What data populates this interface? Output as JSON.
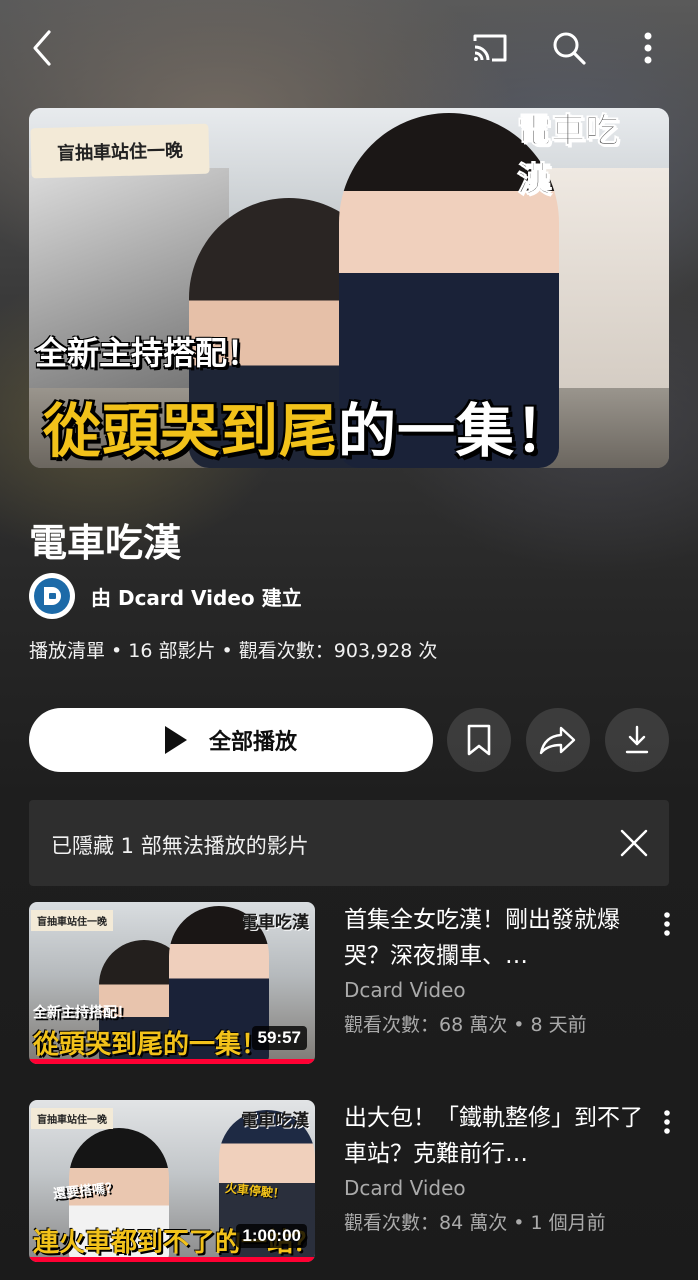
{
  "header": {
    "icons": [
      "back-arrow-icon",
      "cast-icon",
      "search-icon",
      "more-vertical-icon"
    ]
  },
  "hero": {
    "tag": "盲抽車站住一晚",
    "logo": "電車吃漢",
    "caption_small": "全新主持搭配！",
    "caption_big_yellow": "從頭哭到尾",
    "caption_big_white": "的一集！"
  },
  "playlist": {
    "title": "電車吃漢",
    "channel_line": "由 Dcard Video 建立",
    "meta": "播放清單 • 16 部影片 • 觀看次數：903,928 次"
  },
  "actions": {
    "play_all": "全部播放",
    "icons": [
      "bookmark-icon",
      "share-icon",
      "download-icon"
    ]
  },
  "notice": {
    "text": "已隱藏 1 部無法播放的影片"
  },
  "videos": [
    {
      "title": "首集全女吃漢！剛出發就爆哭？深夜攔車、…",
      "channel": "Dcard Video",
      "stats": "觀看次數：68 萬次 • 8 天前",
      "duration": "59:57",
      "thumb_tag": "盲抽車站住一晚",
      "thumb_logo": "電車吃漢",
      "thumb_cap_small": "全新主持搭配！",
      "thumb_cap_big": "從頭哭到尾的一集！",
      "progress": 1.0
    },
    {
      "title": "出大包！「鐵軌整修」到不了車站？克難前行…",
      "channel": "Dcard Video",
      "stats": "觀看次數：84 萬次 • 1 個月前",
      "duration": "1:00:00",
      "thumb_tag": "盲抽車站住一晚",
      "thumb_logo": "電車吃漢",
      "thumb_cap_small": "還要搭嗎？",
      "thumb_cap_small2": "火車停駛！",
      "thumb_cap_big": "連火車都到不了的一站？",
      "progress": 1.0
    }
  ],
  "colors": {
    "accent_yellow": "#f2c21a",
    "progress_red": "#ff0033",
    "secondary_text": "#aaaaaa",
    "notice_bg": "#2e2e2e",
    "avatar_blue": "#1c6aa8"
  }
}
